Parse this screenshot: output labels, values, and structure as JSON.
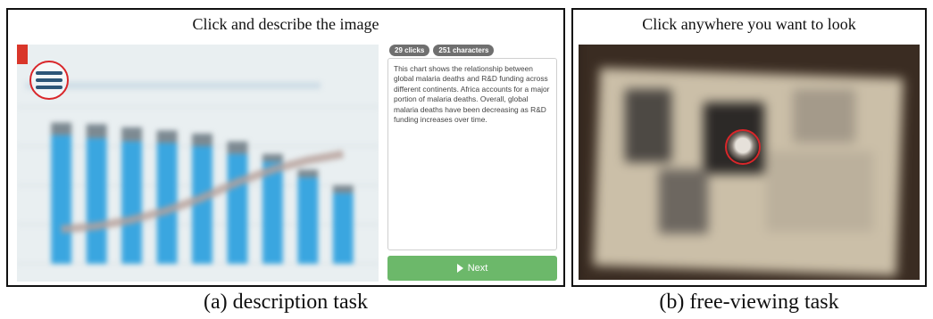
{
  "panel_a": {
    "title": "Click and describe the image",
    "badges": [
      "29 clicks",
      "251 characters"
    ],
    "description": "This chart shows the relationship between global malaria deaths and R&D funding across different continents. Africa accounts for a major portion of malaria deaths. Overall, global malaria deaths have been decreasing as R&D funding increases over time.",
    "next_label": "Next",
    "next_icon": "play-icon",
    "chart_fragments": [
      "al ma",
      "al malaria",
      "frica"
    ]
  },
  "panel_b": {
    "title": "Click anywhere you want to look"
  },
  "captions": {
    "a": "(a) description task",
    "b": "(b) free-viewing task"
  },
  "colors": {
    "bar": "#3aa6e0",
    "bar_top": "#7d8a92",
    "trend": "#b7a09a",
    "gaze": "#d9262a",
    "next": "#6cb86a"
  },
  "chart_data": {
    "type": "bar",
    "note_values_blurred": true,
    "values": [
      82,
      80,
      78,
      77,
      75,
      70,
      65,
      55,
      45
    ],
    "top_values": [
      90,
      89,
      87,
      85,
      83,
      78,
      70,
      60,
      50
    ],
    "trend": [
      22,
      24,
      28,
      34,
      42,
      52,
      60,
      66,
      70
    ],
    "ylim": [
      0,
      100
    ]
  }
}
